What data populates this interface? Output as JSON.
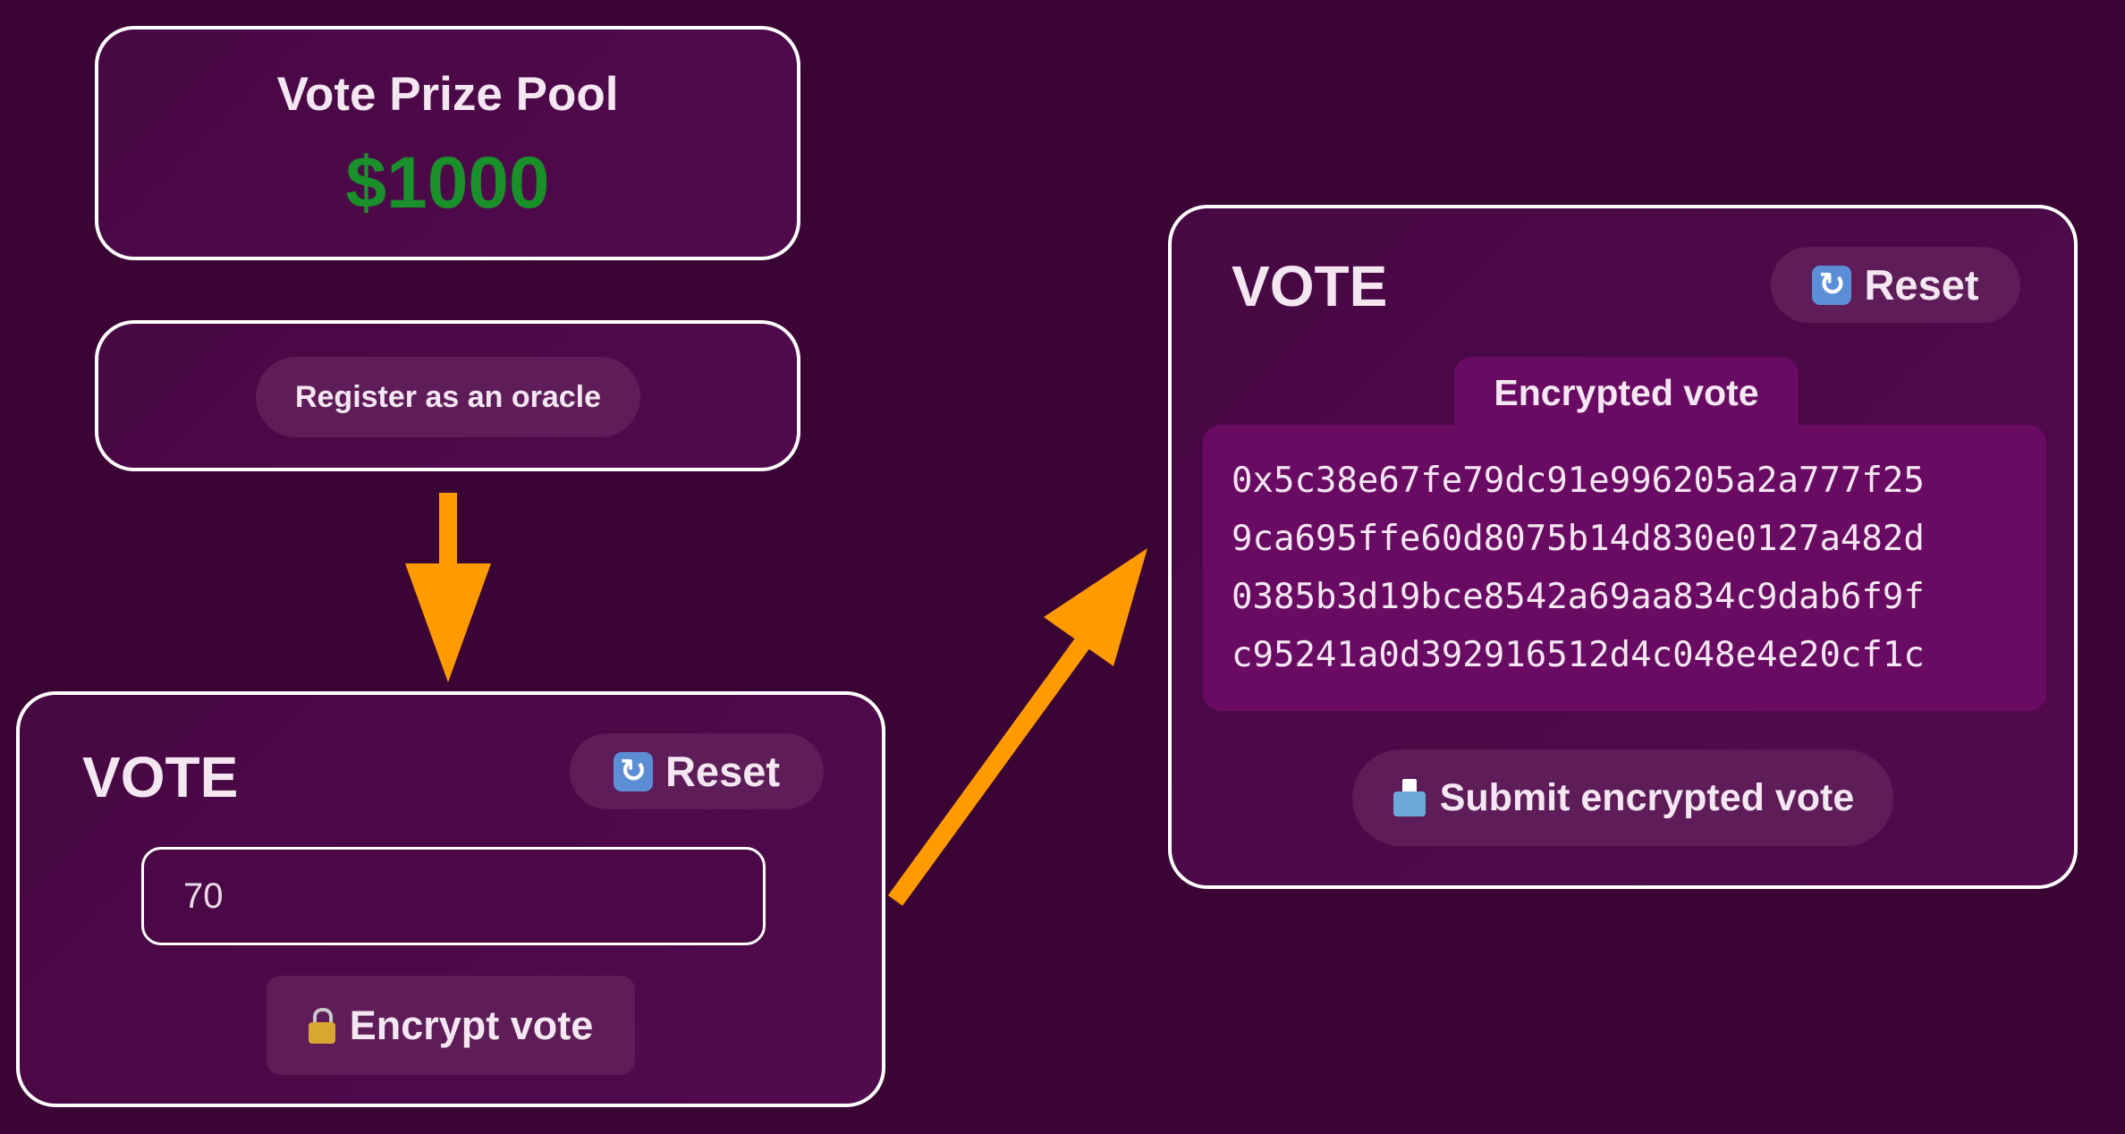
{
  "prize_pool": {
    "title": "Vote Prize Pool",
    "amount": "$1000",
    "amount_color": "#19902a"
  },
  "register": {
    "button_label": "Register as an oracle"
  },
  "vote_left": {
    "heading": "VOTE",
    "reset_label": "Reset",
    "reset_icon": "arrows-counterclockwise-icon",
    "input_value": "70",
    "encrypt_label": "Encrypt vote",
    "encrypt_icon": "lock-icon"
  },
  "vote_right": {
    "heading": "VOTE",
    "reset_label": "Reset",
    "reset_icon": "arrows-counterclockwise-icon",
    "encrypted_tab_label": "Encrypted vote",
    "encrypted_lines": [
      "0x5c38e67fe79dc91e996205a2a777f25",
      "9ca695ffe60d8075b14d830e0127a482d",
      "0385b3d19bce8542a69aa834c9dab6f9f",
      "c95241a0d392916512d4c048e4e20cf1c"
    ],
    "submit_label": "Submit encrypted vote",
    "submit_icon": "ballot-box-icon"
  },
  "colors": {
    "background": "#3a0435",
    "card": "#4d0949",
    "button": "#5e1c58",
    "encrypted_panel": "#6a0b63",
    "arrow": "#ff9a00"
  }
}
